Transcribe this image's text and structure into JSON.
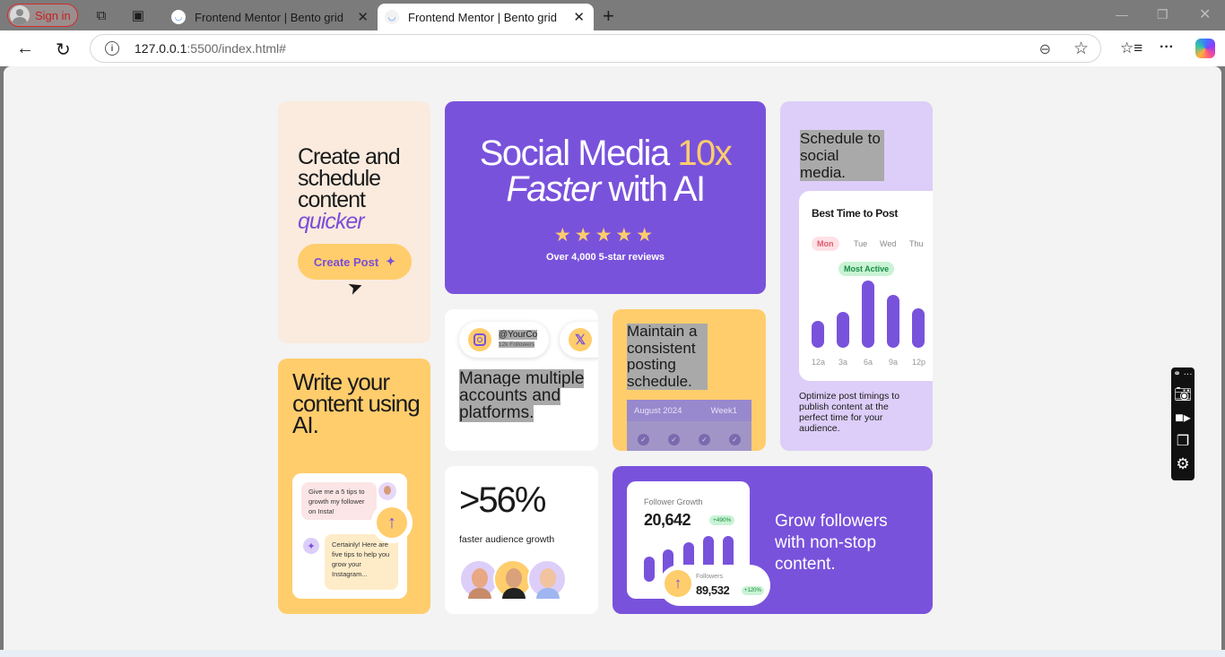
{
  "browser": {
    "signin_label": "Sign in",
    "tabs": [
      {
        "title": "Frontend Mentor | Bento grid",
        "active": false
      },
      {
        "title": "Frontend Mentor | Bento grid",
        "active": true
      }
    ],
    "url_host": "127.0.0.1",
    "url_path": ":5500/index.html#",
    "icons": [
      "back-icon",
      "refresh-icon",
      "info-icon",
      "zoom-out-icon",
      "favorite-star-icon",
      "favorites-icon",
      "more-icon",
      "copilot-icon"
    ]
  },
  "cards": {
    "create": {
      "title_line": "Create and schedule content",
      "title_accent": "quicker",
      "button": "Create Post",
      "button_icon": "✦"
    },
    "hero": {
      "title_a": "Social Media ",
      "title_accent": "10x",
      "title_italic": "Faster",
      "title_b": " with AI",
      "stars": "★★★★★",
      "reviews": "Over 4,000 5-star reviews"
    },
    "schedule": {
      "title": "Schedule to social media.",
      "chart_title": "Best Time to Post",
      "days": [
        "Mon",
        "Tue",
        "Wed",
        "Thu"
      ],
      "badge": "Most Active",
      "times": [
        "12a",
        "3a",
        "6a",
        "9a",
        "12p"
      ],
      "description": "Optimize post timings to publish content at the perfect time for your audience."
    },
    "write": {
      "title": "Write your content using AI.",
      "question": "Give me a 5 tips to growth my follower on Insta!",
      "answer": "Certainly! Here are five tips to help you grow your Instagram..."
    },
    "manage": {
      "handle": "@YourCo",
      "followers": "12k Followers",
      "x_icon": "𝕏",
      "title": "Manage multiple accounts and platforms."
    },
    "consistent": {
      "title": "Maintain a consistent posting schedule.",
      "month": "August 2024",
      "week": "Week1"
    },
    "stat": {
      "value": ">56%",
      "caption": "faster audience growth"
    },
    "grow": {
      "growth_label": "Follower Growth",
      "growth_value": "20,642",
      "growth_pct": "+490%",
      "followers_label": "Followers",
      "followers_value": "89,532",
      "followers_pct": "+120%",
      "title": "Grow followers with non-stop content."
    }
  },
  "colors": {
    "purple": "#7952dc",
    "yellow": "#ffcd6c",
    "lilac": "#dccef8",
    "cream": "#faebde"
  }
}
